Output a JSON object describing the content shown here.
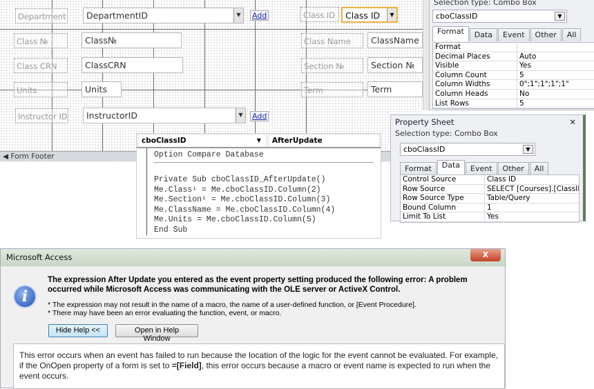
{
  "form": {
    "department_label": "Department",
    "department_value": "DepartmentID",
    "add1": "Add",
    "classid_label": "Class ID",
    "classid_value": "Class ID",
    "classno_label": "Class №",
    "classno_value": "Class№",
    "classname_label": "Class Name",
    "classname_value": "ClassName",
    "classcrn_label": "Class CRN",
    "classcrn_value": "ClassCRN",
    "section_label": "Section №",
    "section_value": "Section №",
    "units_label": "Units",
    "units_value": "Units",
    "term_label": "Term",
    "term_value": "Term",
    "instructor_label": "Instructor ID",
    "instructor_value": "InstructorID",
    "add2": "Add",
    "footer": "Form Footer"
  },
  "prop1": {
    "selection_type": "Selection type:  Combo Box",
    "object": "cboClassID",
    "tabs": [
      "Format",
      "Data",
      "Event",
      "Other",
      "All"
    ],
    "rows": [
      [
        "Format",
        ""
      ],
      [
        "Decimal Places",
        "Auto"
      ],
      [
        "Visible",
        "Yes"
      ],
      [
        "Column Count",
        "5"
      ],
      [
        "Column Widths",
        "0\";1\";1\";1\";1\""
      ],
      [
        "Column Heads",
        "No"
      ],
      [
        "List Rows",
        "5"
      ]
    ]
  },
  "prop2": {
    "title": "Property Sheet",
    "close": "✕",
    "selection_type": "Selection type:  Combo Box",
    "object": "cboClassID",
    "tabs": [
      "Format",
      "Data",
      "Event",
      "Other",
      "All"
    ],
    "rows": [
      [
        "Control Source",
        "Class ID"
      ],
      [
        "Row Source",
        "SELECT [Courses].[ClassID],"
      ],
      [
        "Row Source Type",
        "Table/Query"
      ],
      [
        "Bound Column",
        "1"
      ],
      [
        "Limit To List",
        "Yes"
      ]
    ]
  },
  "code": {
    "object": "cboClassID",
    "procedure": "AfterUpdate",
    "lines": [
      "Option Compare Database",
      "",
      "Private Sub cboClassID_AfterUpdate()",
      "Me.Class¹ = Me.cboClassID.Column(2)",
      "Me.Section¹ = Me.cboClassID.Column(3)",
      "Me.ClassName = Me.cboClassID.Column(4)",
      "Me.Units = Me.cboClassID.Column(5)",
      "End Sub"
    ]
  },
  "dialog": {
    "title": "Microsoft Access",
    "close": "X",
    "message": "The expression After Update you entered as the event property setting produced the following error: A problem occurred while Microsoft Access was communicating with the OLE server or ActiveX Control.",
    "bullet1": "* The expression may not result in the name of a macro, the name of a user-defined function, or [Event Procedure].",
    "bullet2": "* There may have been an error evaluating the function, event, or macro.",
    "hide_help": "Hide Help <<",
    "open_help": "Open in Help Window",
    "help_pre": "This error occurs when an event has failed to run because the location of the logic for the event cannot be evaluated. For example, if the OnOpen property of a form is set to ",
    "help_bold": "=[Field]",
    "help_post": ", this error occurs because a macro or event name is expected to run when the event occurs."
  }
}
